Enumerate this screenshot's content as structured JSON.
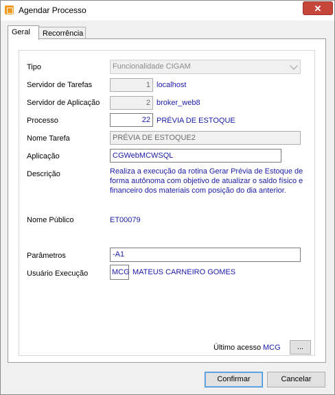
{
  "window": {
    "title": "Agendar Processo",
    "close_glyph": "✕"
  },
  "tabs": [
    {
      "label": "Geral",
      "active": true
    },
    {
      "label": "Recorrência",
      "active": false
    }
  ],
  "form": {
    "tipo": {
      "label": "Tipo",
      "value": "Funcionalidade CIGAM"
    },
    "servidor_tarefas": {
      "label": "Servidor de Tarefas",
      "code": "1",
      "name": "localhost"
    },
    "servidor_aplicacao": {
      "label": "Servidor de Aplicação",
      "code": "2",
      "name": "broker_web8"
    },
    "processo": {
      "label": "Processo",
      "code": "22",
      "name": "PRÉVIA DE ESTOQUE"
    },
    "nome_tarefa": {
      "label": "Nome Tarefa",
      "value": "PRÉVIA DE ESTOQUE2"
    },
    "aplicacao": {
      "label": "Aplicação",
      "value": "CGWebMCWSQL"
    },
    "descricao": {
      "label": "Descrição",
      "value": "Realiza a execução da rotina Gerar Prévia de Estoque de forma autônoma com objetivo de atualizar o saldo físico e financeiro dos materiais com posição do dia anterior."
    },
    "nome_publico": {
      "label": "Nome Público",
      "value": "ET00079"
    },
    "parametros": {
      "label": "Parâmetros",
      "value": "-A1"
    },
    "usuario_execucao": {
      "label": "Usuário Execução",
      "code": "MCG",
      "name": "MATEUS CARNEIRO GOMES"
    },
    "ultimo_acesso": {
      "label": "Último acesso",
      "value": "MCG",
      "button": "..."
    }
  },
  "buttons": {
    "confirm": "Confirmar",
    "cancel": "Cancelar"
  },
  "colors": {
    "value_text": "#1a1aa8",
    "close": "#c7463c",
    "focus": "#3b8fdb"
  }
}
